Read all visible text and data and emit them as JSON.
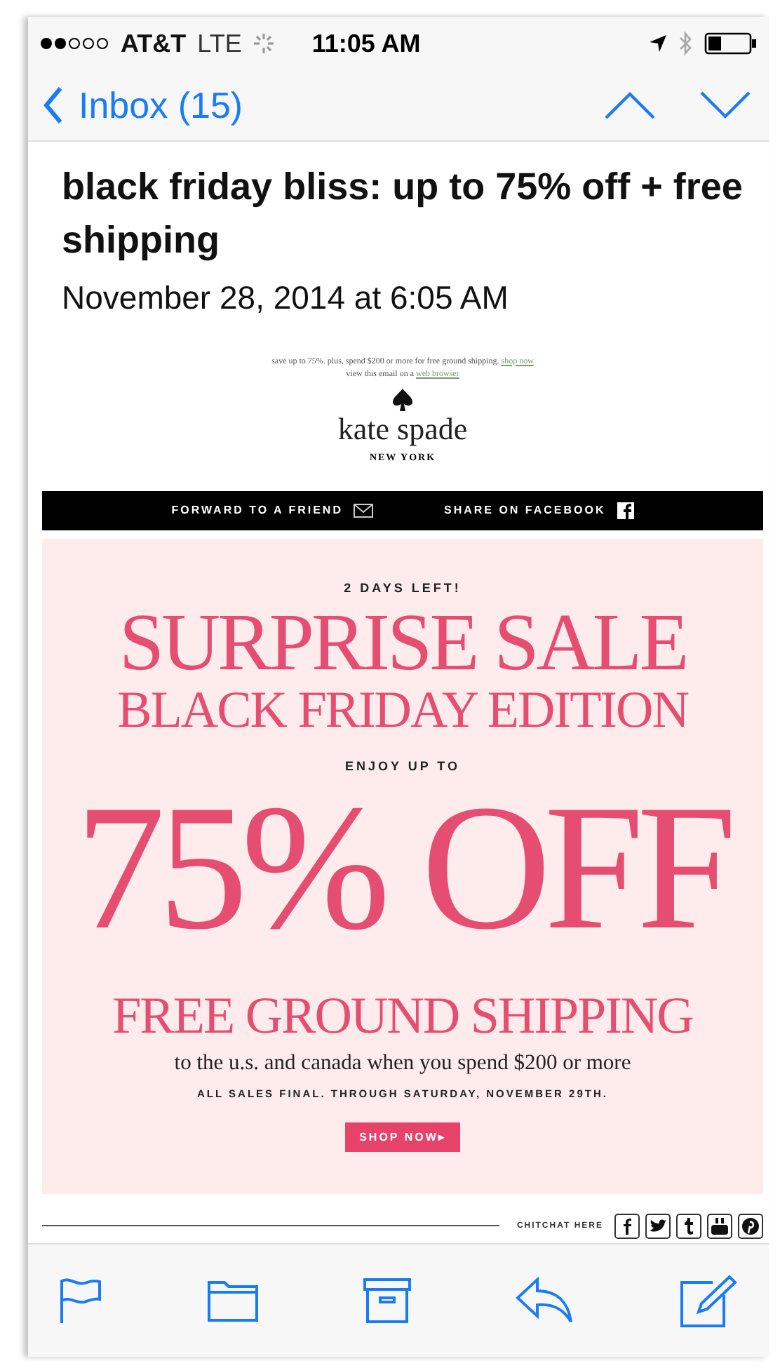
{
  "status_bar": {
    "carrier": "AT&T",
    "network": "LTE",
    "time": "11:05 AM"
  },
  "nav_bar": {
    "back_label": "Inbox (15)"
  },
  "message": {
    "subject": "black friday bliss: up to 75% off + free shipping",
    "date": "November 28, 2014 at 6:05 AM"
  },
  "email": {
    "preheader": "save up to 75%. plus, spend $200 or more for free ground shipping.",
    "preheader_link": "shop now",
    "view_text": "view this email on a",
    "view_link": "web browser",
    "brand": "kate spade",
    "brand_sub": "NEW YORK",
    "share_links": [
      {
        "label": "FORWARD TO A FRIEND",
        "kind": "mail"
      },
      {
        "label": "SHARE ON FACEBOOK",
        "kind": "facebook"
      }
    ],
    "countdown": "2 DAYS LEFT!",
    "headline": "SURPRISE SALE",
    "subhead": "BLACK FRIDAY EDITION",
    "enjoy": "ENJOY UP TO",
    "discount": "75% OFF",
    "shipping": "FREE GROUND SHIPPING",
    "shipping_note": "to the u.s. and canada when you spend $200 or more",
    "terms": "ALL SALES FINAL. THROUGH SATURDAY, NOVEMBER 29TH.",
    "cta": "SHOP NOW▸",
    "social_label": "CHITCHAT HERE",
    "social": [
      {
        "kind": "facebook"
      },
      {
        "kind": "twitter"
      },
      {
        "kind": "tumblr"
      },
      {
        "kind": "youtube"
      },
      {
        "kind": "pinterest"
      }
    ]
  },
  "toolbar": [
    {
      "kind": "flag"
    },
    {
      "kind": "folder"
    },
    {
      "kind": "archive"
    },
    {
      "kind": "reply"
    },
    {
      "kind": "compose"
    }
  ]
}
